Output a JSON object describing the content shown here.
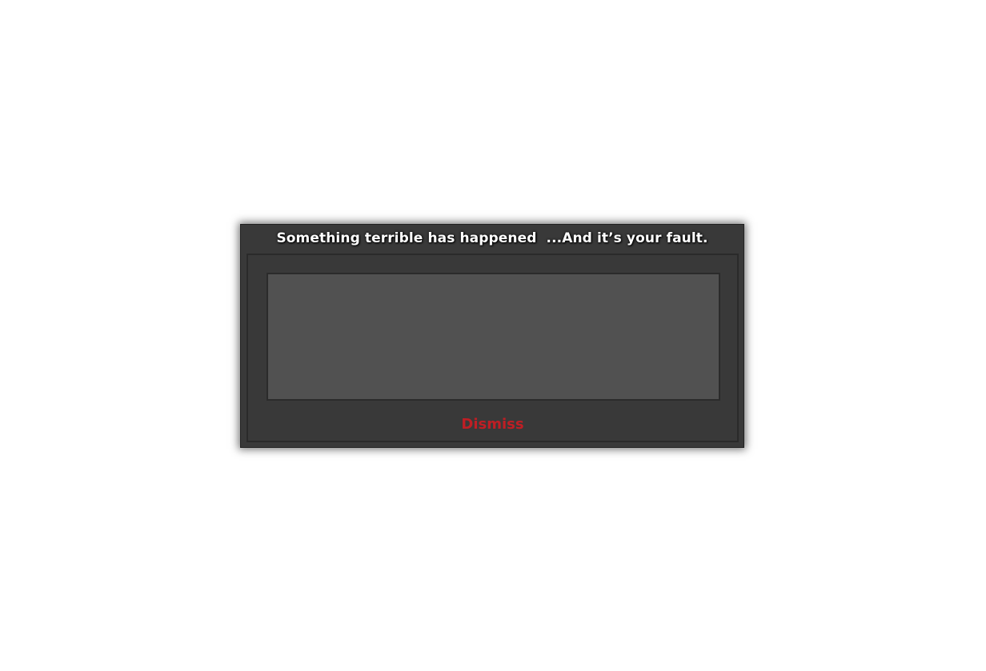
{
  "dialog": {
    "title": "Something terrible has happened  ...And it’s your fault.",
    "message": "",
    "dismiss_label": "Dismiss"
  },
  "colors": {
    "page_background": "#ffffff",
    "dialog_background": "#393939",
    "message_area_background": "#515151",
    "title_text": "#ffffff",
    "dismiss_text": "#bf1e24"
  }
}
